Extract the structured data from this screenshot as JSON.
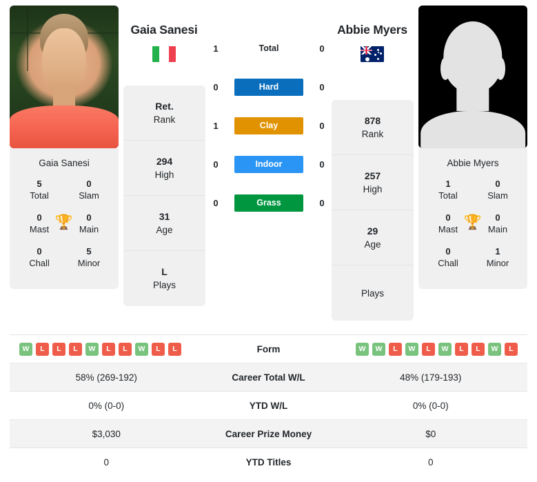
{
  "players": {
    "left": {
      "name": "Gaia Sanesi",
      "flag": "it-flag-icon",
      "photo_caption": "Gaia Sanesi",
      "titles": {
        "total_value": "5",
        "total_label": "Total",
        "slam_value": "0",
        "slam_label": "Slam",
        "mast_value": "0",
        "mast_label": "Mast",
        "main_value": "0",
        "main_label": "Main",
        "chall_value": "0",
        "chall_label": "Chall",
        "minor_value": "5",
        "minor_label": "Minor",
        "trophy_icon": "trophy-icon"
      },
      "profile": [
        {
          "value": "Ret.",
          "label": "Rank"
        },
        {
          "value": "294",
          "label": "High"
        },
        {
          "value": "31",
          "label": "Age"
        },
        {
          "value": "L",
          "label": "Plays"
        }
      ],
      "form": [
        "W",
        "L",
        "L",
        "L",
        "W",
        "L",
        "L",
        "W",
        "L",
        "L"
      ],
      "career_total_wl": "58% (269-192)",
      "ytd_wl": "0% (0-0)",
      "career_prize_money": "$3,030",
      "ytd_titles": "0"
    },
    "right": {
      "name": "Abbie Myers",
      "flag": "au-flag-icon",
      "photo_caption": "Abbie Myers",
      "titles": {
        "total_value": "1",
        "total_label": "Total",
        "slam_value": "0",
        "slam_label": "Slam",
        "mast_value": "0",
        "mast_label": "Mast",
        "main_value": "0",
        "main_label": "Main",
        "chall_value": "0",
        "chall_label": "Chall",
        "minor_value": "1",
        "minor_label": "Minor",
        "trophy_icon": "trophy-icon"
      },
      "profile": [
        {
          "value": "878",
          "label": "Rank"
        },
        {
          "value": "257",
          "label": "High"
        },
        {
          "value": "29",
          "label": "Age"
        },
        {
          "value": "",
          "label": "Plays"
        }
      ],
      "form": [
        "W",
        "W",
        "L",
        "W",
        "L",
        "W",
        "L",
        "L",
        "W",
        "L"
      ],
      "career_total_wl": "48% (179-193)",
      "ytd_wl": "0% (0-0)",
      "career_prize_money": "$0",
      "ytd_titles": "0"
    }
  },
  "head_to_head": [
    {
      "label": "Total",
      "left": "1",
      "right": "0",
      "style": "plain",
      "color": ""
    },
    {
      "label": "Hard",
      "left": "0",
      "right": "0",
      "style": "badge",
      "color": "#0a6ebd"
    },
    {
      "label": "Clay",
      "left": "1",
      "right": "0",
      "style": "badge",
      "color": "#e09200"
    },
    {
      "label": "Indoor",
      "left": "0",
      "right": "0",
      "style": "badge",
      "color": "#2b95f5"
    },
    {
      "label": "Grass",
      "left": "0",
      "right": "0",
      "style": "badge",
      "color": "#009640"
    }
  ],
  "stats_rows": [
    {
      "label": "Form",
      "type": "form"
    },
    {
      "label": "Career Total W/L",
      "type": "text",
      "key": "career_total_wl"
    },
    {
      "label": "YTD W/L",
      "type": "text",
      "key": "ytd_wl"
    },
    {
      "label": "Career Prize Money",
      "type": "text",
      "key": "career_prize_money"
    },
    {
      "label": "YTD Titles",
      "type": "text",
      "key": "ytd_titles"
    }
  ],
  "colors": {
    "win_badge": "#79c37f",
    "loss_badge": "#ef5d4a",
    "panel_bg": "#f0f0f0",
    "row_alt_bg": "#f3f3f3",
    "trophy": "#3b6fb5"
  }
}
